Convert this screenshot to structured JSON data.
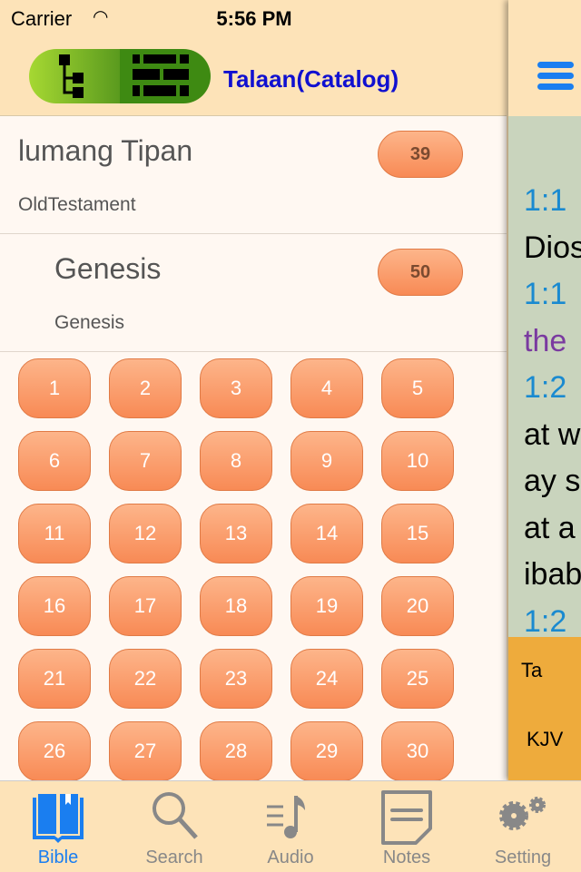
{
  "status": {
    "carrier": "Carrier",
    "time": "5:56 PM"
  },
  "header": {
    "title": "Talaan(Catalog)"
  },
  "testament": {
    "name": "lumang Tipan",
    "subtitle": "OldTestament",
    "count": "39"
  },
  "book": {
    "name": "Genesis",
    "subtitle": "Genesis",
    "count": "50"
  },
  "chapters": [
    "1",
    "2",
    "3",
    "4",
    "5",
    "6",
    "7",
    "8",
    "9",
    "10",
    "11",
    "12",
    "13",
    "14",
    "15",
    "16",
    "17",
    "18",
    "19",
    "20",
    "21",
    "22",
    "23",
    "24",
    "25",
    "26",
    "27",
    "28",
    "29",
    "30"
  ],
  "reader": {
    "lines": [
      {
        "text": "1:1",
        "color": "#1a8ad0"
      },
      {
        "text": "Dios",
        "color": "#000"
      },
      {
        "text": "1:1",
        "color": "#1a8ad0"
      },
      {
        "text": "the",
        "color": "#7a3aa0"
      },
      {
        "text": "1:2",
        "color": "#1a8ad0"
      },
      {
        "text": "at w",
        "color": "#000"
      },
      {
        "text": "ay s",
        "color": "#000"
      },
      {
        "text": "at a",
        "color": "#000"
      },
      {
        "text": "ibab",
        "color": "#000"
      },
      {
        "text": "1:2",
        "color": "#1a8ad0"
      }
    ],
    "footer_lines": [
      "Ta",
      "KJV"
    ]
  },
  "tabs": [
    {
      "label": "Bible",
      "icon": "book-icon",
      "active": true
    },
    {
      "label": "Search",
      "icon": "search-icon"
    },
    {
      "label": "Audio",
      "icon": "music-icon"
    },
    {
      "label": "Notes",
      "icon": "notes-icon"
    },
    {
      "label": "Setting",
      "icon": "gear-icon"
    }
  ],
  "colors": {
    "accent": "#1a7ef0",
    "title": "#1010d0",
    "badge": "#f88a55",
    "background": "#fde3b8"
  }
}
